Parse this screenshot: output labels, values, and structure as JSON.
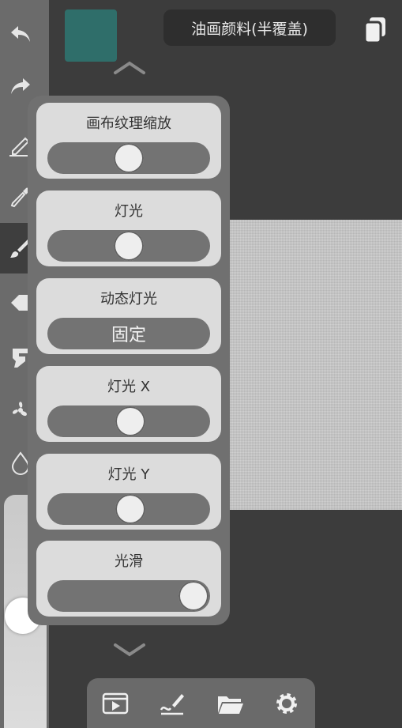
{
  "header": {
    "brush_name": "油画颜料(半覆盖)",
    "current_color": "#2f6e6a"
  },
  "toolbar": {
    "tools": [
      {
        "name": "undo",
        "icon": "undo-icon"
      },
      {
        "name": "redo",
        "icon": "redo-icon"
      },
      {
        "name": "pencil",
        "icon": "pencil-icon"
      },
      {
        "name": "eyedropper",
        "icon": "eyedropper-icon"
      },
      {
        "name": "brush",
        "icon": "brush-icon",
        "active": true
      },
      {
        "name": "eraser",
        "icon": "eraser-icon"
      },
      {
        "name": "smudge",
        "icon": "smudge-icon"
      },
      {
        "name": "blend",
        "icon": "fan-icon"
      },
      {
        "name": "water",
        "icon": "water-drop-icon"
      }
    ]
  },
  "panel": {
    "texture_scale": {
      "label": "画布纹理缩放",
      "value": 0.5
    },
    "lighting": {
      "label": "灯光",
      "value": 0.5
    },
    "dynamic_lighting": {
      "label": "动态灯光",
      "value": "固定"
    },
    "light_x": {
      "label": "灯光 X",
      "value": 0.51
    },
    "light_y": {
      "label": "灯光 Y",
      "value": 0.51
    },
    "smoothing": {
      "label": "光滑",
      "value": 1.0
    }
  },
  "bottom_bar": {
    "items": [
      "video-icon",
      "signature-icon",
      "folder-icon",
      "gear-icon"
    ]
  }
}
